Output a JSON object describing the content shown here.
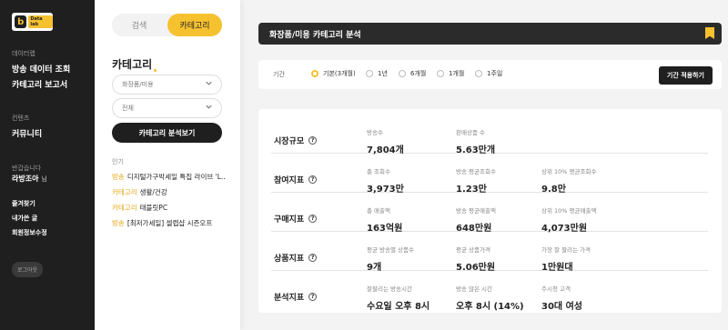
{
  "sidebar": {
    "logo_badge": "Data lab",
    "section_datalab": "데이터랩",
    "item_broadcast": "방송 데이터 조회",
    "item_category": "카테고리 보고서",
    "section_contents": "컨텐츠",
    "item_community": "커뮤니티",
    "welcome": "반갑습니다",
    "user_name": "라방조아",
    "user_suffix": "님",
    "favorites": "즐겨찾기",
    "my_posts": "내가쓴 글",
    "edit_info": "회원정보수정",
    "logout": "로그아웃"
  },
  "panel": {
    "tab_search": "검색",
    "tab_category": "카테고리",
    "title": "카테고리",
    "select1_placeholder": "화장품/미용",
    "select2_value": "전체",
    "analyze_button": "카테고리 분석보기",
    "popular_label": "인기",
    "popular": [
      {
        "tag": "방송",
        "text": "디지털가구박세일 특집 라이브 'L…"
      },
      {
        "tag": "카테고리",
        "text": "생활/건강"
      },
      {
        "tag": "카테고리",
        "text": "태블릿PC"
      },
      {
        "tag": "방송",
        "text": "[최저가세일] 셀렙샵 시즌오프"
      }
    ]
  },
  "main": {
    "header_title": "화장품/미용 카테고리 분석",
    "period_label": "기간",
    "period_options": [
      "기본(3개월)",
      "1년",
      "6개월",
      "1개월",
      "1주일"
    ],
    "period_selected": "기본(3개월)",
    "apply_button": "기간 적용하기",
    "rows": [
      {
        "label": "시장규모",
        "cells": [
          {
            "k": "방송수",
            "v": "7,804개"
          },
          {
            "k": "판매상품 수",
            "v": "5.63만개"
          }
        ]
      },
      {
        "label": "참여지표",
        "cells": [
          {
            "k": "총 조회수",
            "v": "3,973만"
          },
          {
            "k": "방송 평균조회수",
            "v": "1.23만"
          },
          {
            "k": "상위 10% 평균조회수",
            "v": "9.8만"
          }
        ]
      },
      {
        "label": "구매지표",
        "cells": [
          {
            "k": "총 매출액",
            "v": "163억원"
          },
          {
            "k": "방송 평균매출액",
            "v": "648만원"
          },
          {
            "k": "상위 10% 평균매출액",
            "v": "4,073만원"
          }
        ]
      },
      {
        "label": "상품지표",
        "cells": [
          {
            "k": "평균 방송별 상품수",
            "v": "9개"
          },
          {
            "k": "평균 상품가격",
            "v": "5.06만원"
          },
          {
            "k": "가장 잘 팔리는 가격",
            "v": "1만원대"
          }
        ]
      },
      {
        "label": "분석지표",
        "cells": [
          {
            "k": "잘팔리는 방송시간",
            "v": "수요일 오후 8시"
          },
          {
            "k": "방송 많은 시간",
            "v": "오후 8시 (14%)"
          },
          {
            "k": "주시청 고객",
            "v": "30대 여성"
          }
        ]
      }
    ]
  },
  "colors": {
    "accent": "#f6c12f",
    "dark": "#1f1f1f"
  }
}
